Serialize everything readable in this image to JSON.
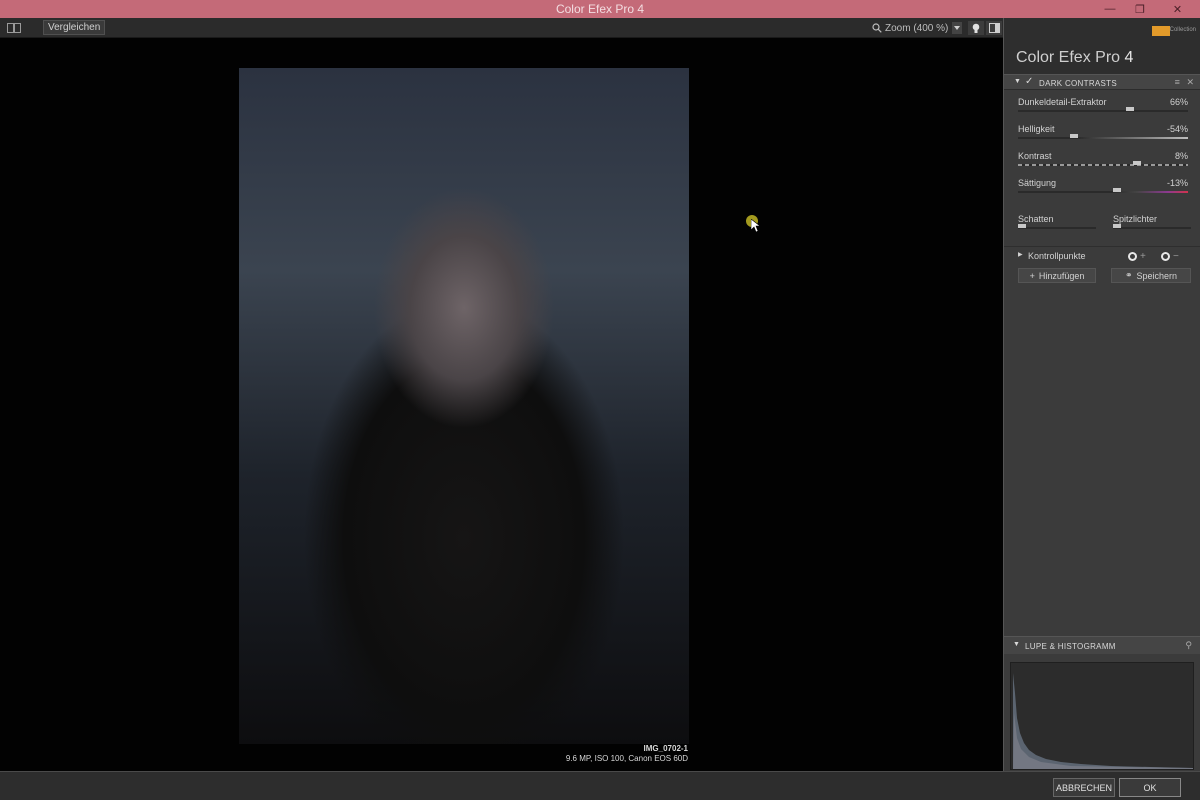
{
  "window": {
    "title": "Color Efex Pro 4"
  },
  "toolbar": {
    "compare_label": "Vergleichen",
    "zoom_label": "Zoom (400 %)"
  },
  "image": {
    "name": "IMG_0702-1",
    "meta": "9.6 MP, ISO 100, Canon EOS 60D"
  },
  "panel": {
    "brand_name": "Color Efex Pro",
    "brand_version": "4",
    "logo_text": "Collection",
    "filter_name": "DARK CONTRASTS",
    "sliders": [
      {
        "label": "Dunkeldetail-Extraktor",
        "value": "66%",
        "level": 0.66
      },
      {
        "label": "Helligkeit",
        "value": "-54%",
        "level": 0.33
      },
      {
        "label": "Kontrast",
        "value": "8%",
        "level": 0.7
      },
      {
        "label": "Sättigung",
        "value": "-13%",
        "level": 0.58
      }
    ],
    "shadows_label": "Schatten",
    "highlights_label": "Spitzlichter",
    "control_points_label": "Kontrollpunkte",
    "add_label": "Hinzufügen",
    "save_label": "Speichern",
    "loupe_label": "LUPE & HISTOGRAMM"
  },
  "footer": {
    "cancel_label": "ABBRECHEN",
    "ok_label": "OK"
  },
  "colors": {
    "titlebar": "#c46a78",
    "panel_bg": "#3b3b3b",
    "accent_logo": "#e29a2a"
  }
}
